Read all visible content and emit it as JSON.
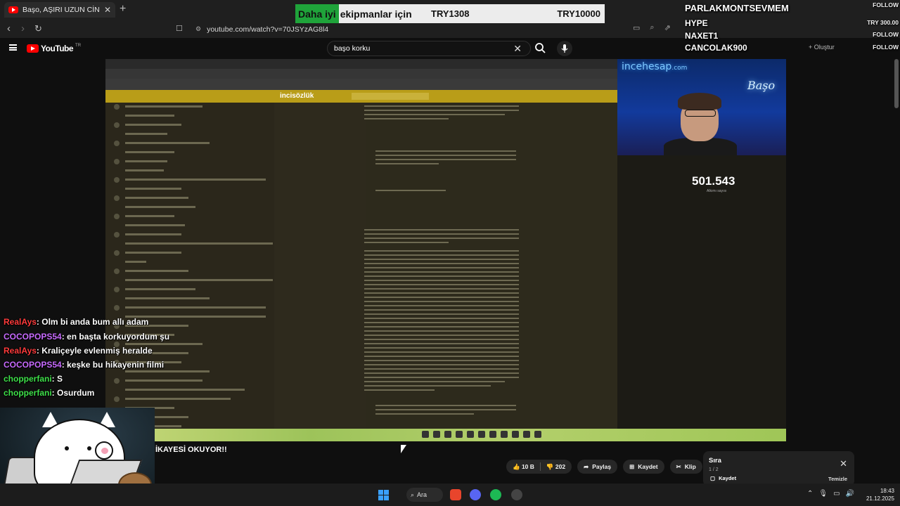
{
  "browser": {
    "tab_title": "Başo, AŞIRI UZUN CİNLİ KORKU",
    "url": "youtube.com/watch?v=70JSYzAG8l4"
  },
  "promo": {
    "highlight": "Daha iyi",
    "text": "ekipmanlar için",
    "price_old": "TRY1308",
    "price_new": "TRY10000"
  },
  "followers": [
    {
      "name": "PARLAKMONTSEVMEM",
      "tag": "FOLLOW"
    },
    {
      "name": "HYPE",
      "tag": "TRY 300.00"
    },
    {
      "name": "NAXET1",
      "tag": "FOLLOW"
    },
    {
      "name": "CANCOLAK900",
      "tag": "FOLLOW"
    }
  ],
  "youtube": {
    "logo": "YouTube",
    "region": "TR",
    "search_value": "başo korku",
    "create_label": "Oluştur"
  },
  "stream": {
    "view_count": "501.543",
    "view_label": "Alkımı sayısı",
    "cam_sign": "incehesap",
    "cam_sign_suffix": ".com",
    "cam_neon": "Başo",
    "site_logo": "incisözlük"
  },
  "chat": [
    {
      "user": "RealAys",
      "user_color": "#ff3b3b",
      "msg": ": Olm bi anda bum allı adam"
    },
    {
      "user": "COCOPOPS54",
      "user_color": "#c86bff",
      "msg": ": en başta korkuyordum şu"
    },
    {
      "user": "RealAys",
      "user_color": "#ff3b3b",
      "msg": ": Kraliçeyle evlenmiş heralde"
    },
    {
      "user": "COCOPOPS54",
      "user_color": "#c86bff",
      "msg": ": keşke bu hikayenin filmi"
    },
    {
      "user": "chopperfani",
      "user_color": "#3fe04a",
      "msg": ": S"
    },
    {
      "user": "chopperfani",
      "user_color": "#3fe04a",
      "msg": ": Osurdum"
    }
  ],
  "video": {
    "title": "İKAYESİ OKUYOR!!",
    "likes": "10 B",
    "dislikes": "202",
    "share": "Paylaş",
    "save": "Kaydet",
    "clip": "Klip",
    "more": "⋯"
  },
  "queue": {
    "title": "Sıra",
    "count": "1 / 2",
    "save": "Kaydet",
    "clear": "Temizle"
  },
  "taskbar": {
    "search": "Ara",
    "time": "18:43",
    "date": "21.12.2025"
  }
}
